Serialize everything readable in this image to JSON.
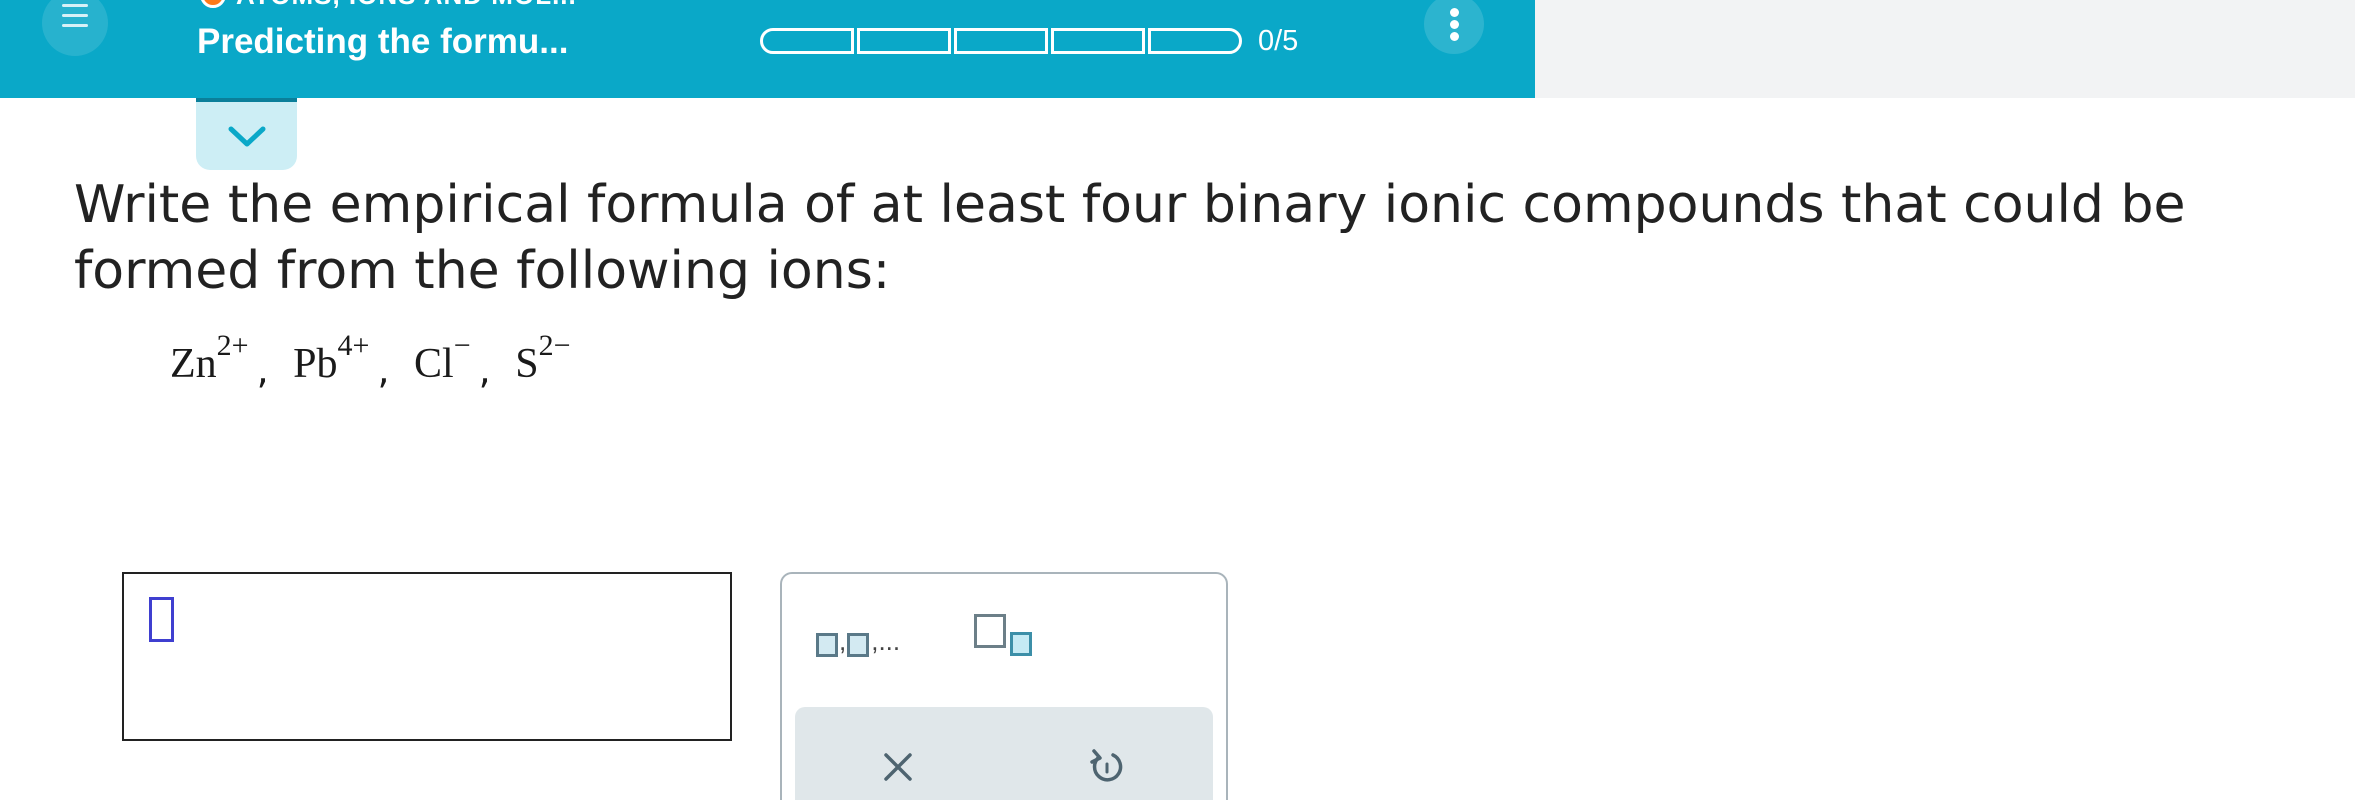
{
  "header": {
    "category": "ATOMS, IONS AND MOL...",
    "title": "Predicting the formu...",
    "progress": {
      "label": "0/5",
      "completed": 0,
      "total": 5
    },
    "colors": {
      "bar": "#0aa8c8",
      "status_dot": "#ff7a1a"
    }
  },
  "icons": {
    "menu": "hamburger-menu-icon",
    "more": "vertical-dots-icon",
    "collapse": "chevron-down-icon",
    "clear": "x-icon",
    "undo": "undo-icon"
  },
  "question": {
    "text": "Write the empirical formula of at least four binary ionic compounds that could be formed from the following ions:",
    "ions": [
      {
        "symbol": "Zn",
        "charge": "2+"
      },
      {
        "symbol": "Pb",
        "charge": "4+"
      },
      {
        "symbol": "Cl",
        "charge": "−"
      },
      {
        "symbol": "S",
        "charge": "2−"
      }
    ]
  },
  "answer": {
    "value": ""
  },
  "palette": {
    "list_button_label": ",...",
    "subscript_button_label": ""
  }
}
